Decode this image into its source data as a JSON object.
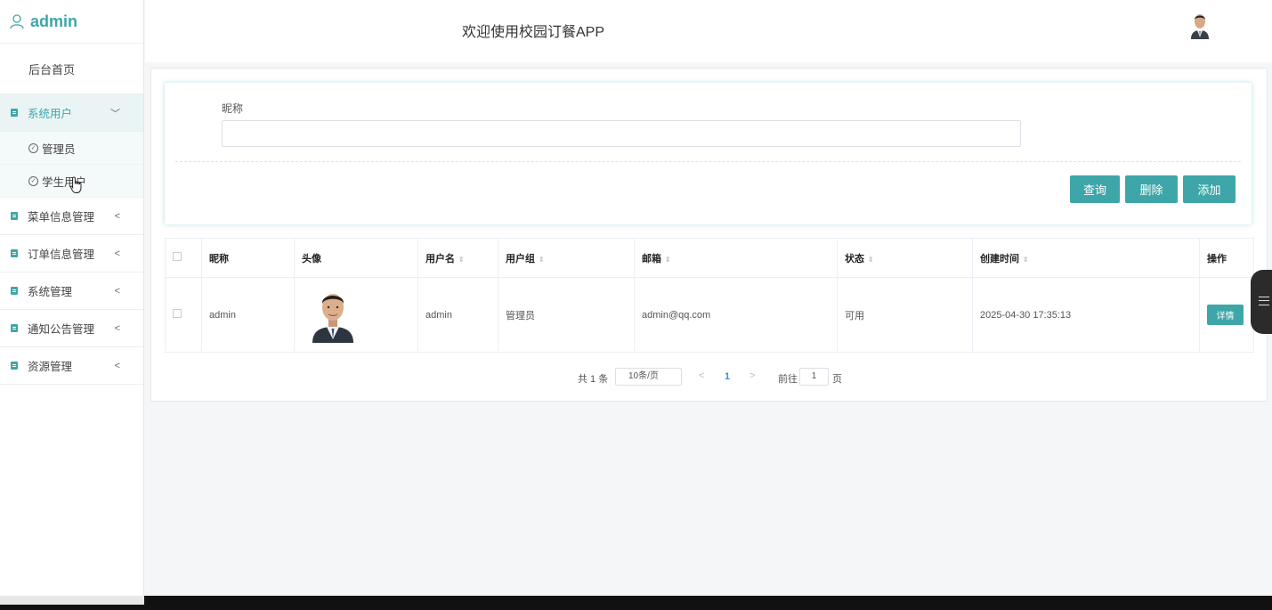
{
  "sidebar": {
    "brand": "admin",
    "home": "后台首页",
    "groups": [
      {
        "label": "系统用户",
        "arrow": "﹀"
      },
      {
        "label": "菜单信息管理",
        "arrow": "<"
      },
      {
        "label": "订单信息管理",
        "arrow": "<"
      },
      {
        "label": "系统管理",
        "arrow": "<"
      },
      {
        "label": "通知公告管理",
        "arrow": "<"
      },
      {
        "label": "资源管理",
        "arrow": "<"
      }
    ],
    "subitems": [
      {
        "label": "管理员"
      },
      {
        "label": "学生用户"
      }
    ]
  },
  "header": {
    "title": "欢迎使用校园订餐APP"
  },
  "search": {
    "nickname_label": "昵称",
    "nickname_value": "",
    "buttons": {
      "query": "查询",
      "delete": "删除",
      "add": "添加"
    }
  },
  "table": {
    "columns": [
      "昵称",
      "头像",
      "用户名",
      "用户组",
      "邮箱",
      "状态",
      "创建时间",
      "操作"
    ],
    "rows": [
      {
        "nickname": "admin",
        "username": "admin",
        "group": "管理员",
        "email": "admin@qq.com",
        "status": "可用",
        "created": "2025-04-30 17:35:13",
        "action": "详情"
      }
    ]
  },
  "pagination": {
    "total": "共 1 条",
    "page_size": "10条/页",
    "prev": "<",
    "current_page": "1",
    "next": ">",
    "goto_label": "前往",
    "goto_value": "1",
    "page_unit": "页"
  },
  "colors": {
    "accent": "#3ea6a8",
    "page_link": "#3a8ee6"
  }
}
